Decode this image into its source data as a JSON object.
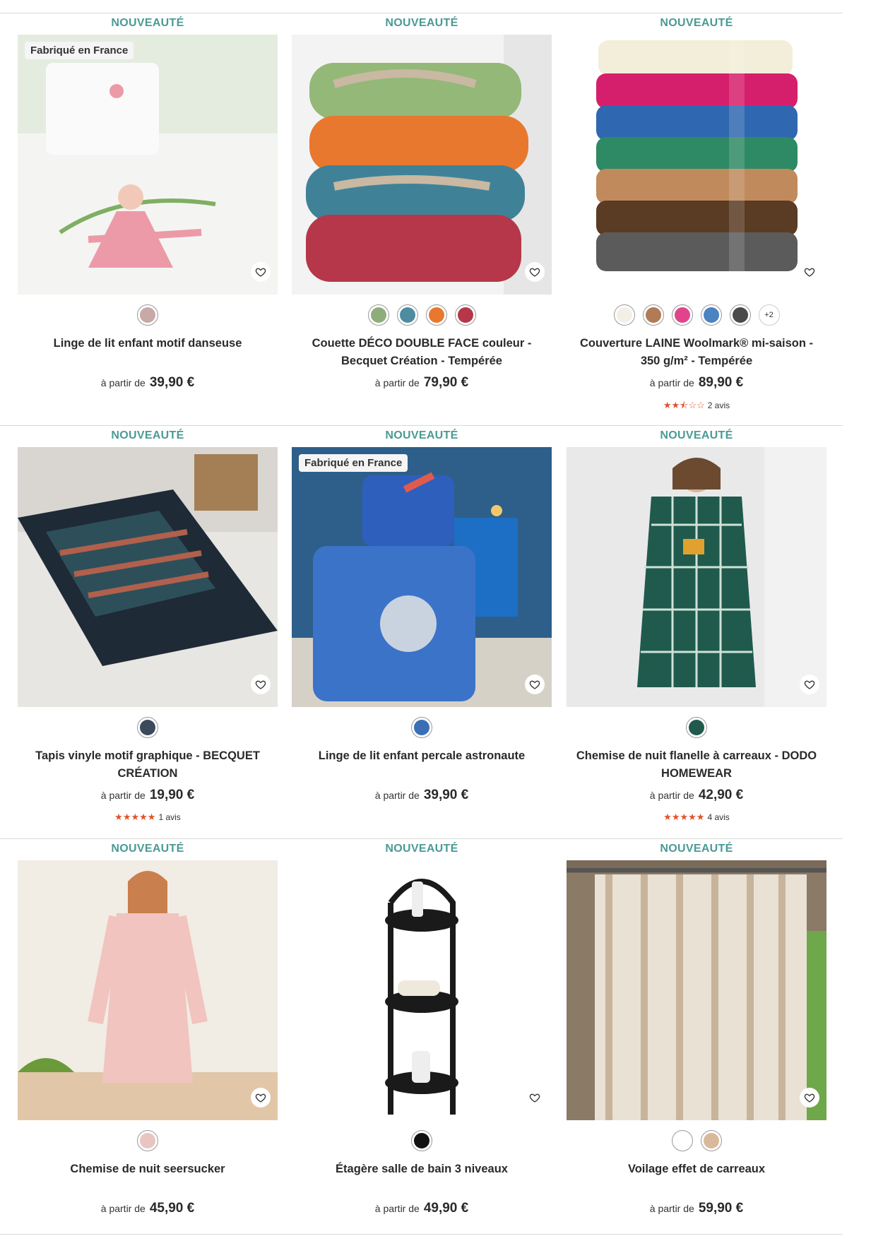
{
  "colors": {
    "accent": "#4a9a95",
    "star": "#e0542c"
  },
  "products": [
    {
      "badge": "NOUVEAUTÉ",
      "tag": "Fabriqué en France",
      "title": "Linge de lit enfant motif danseuse",
      "price_from": "à partir de",
      "price": "39,90 €",
      "swatches": [
        "#c9a8a8"
      ],
      "more": "",
      "rating": null,
      "reviews": ""
    },
    {
      "badge": "NOUVEAUTÉ",
      "tag": "",
      "title": "Couette DÉCO DOUBLE FACE couleur - Becquet Création - Tempérée",
      "price_from": "à partir de",
      "price": "79,90 €",
      "swatches": [
        "#8fad7b",
        "#4e8ca0",
        "#e8782e",
        "#b53749"
      ],
      "more": "",
      "rating": null,
      "reviews": ""
    },
    {
      "badge": "NOUVEAUTÉ",
      "tag": "",
      "title": "Couverture LAINE Woolmark® mi-saison - 350 g/m² - Tempérée",
      "price_from": "à partir de",
      "price": "89,90 €",
      "swatches": [
        "#f3efe6",
        "#b07b55",
        "#e0458c",
        "#4a82c2",
        "#4a4a4a"
      ],
      "more": "+2",
      "rating": 2.5,
      "reviews": "2 avis"
    },
    {
      "badge": "NOUVEAUTÉ",
      "tag": "",
      "title": "Tapis vinyle motif graphique - BECQUET CRÉATION",
      "price_from": "à partir de",
      "price": "19,90 €",
      "swatches": [
        "#3b4a5c"
      ],
      "more": "",
      "rating": 5,
      "reviews": "1 avis"
    },
    {
      "badge": "NOUVEAUTÉ",
      "tag": "Fabriqué en France",
      "title": "Linge de lit enfant percale astronaute",
      "price_from": "à partir de",
      "price": "39,90 €",
      "swatches": [
        "#3b6fb5"
      ],
      "more": "",
      "rating": null,
      "reviews": ""
    },
    {
      "badge": "NOUVEAUTÉ",
      "tag": "",
      "title": "Chemise de nuit flanelle à carreaux - DODO HOMEWEAR",
      "price_from": "à partir de",
      "price": "42,90 €",
      "swatches": [
        "#1f5a4d"
      ],
      "more": "",
      "rating": 5,
      "reviews": "4 avis"
    },
    {
      "badge": "NOUVEAUTÉ",
      "tag": "",
      "title": "Chemise de nuit seersucker",
      "price_from": "à partir de",
      "price": "45,90 €",
      "swatches": [
        "#e9c4c0"
      ],
      "more": "",
      "rating": null,
      "reviews": ""
    },
    {
      "badge": "NOUVEAUTÉ",
      "tag": "",
      "title": "Étagère salle de bain 3 niveaux",
      "price_from": "à partir de",
      "price": "49,90 €",
      "swatches": [
        "#111111"
      ],
      "more": "",
      "rating": null,
      "reviews": ""
    },
    {
      "badge": "NOUVEAUTÉ",
      "tag": "",
      "title": "Voilage effet de carreaux",
      "price_from": "à partir de",
      "price": "59,90 €",
      "swatches": [
        "#ffffff",
        "#d8b99a"
      ],
      "more": "",
      "rating": null,
      "reviews": ""
    }
  ]
}
